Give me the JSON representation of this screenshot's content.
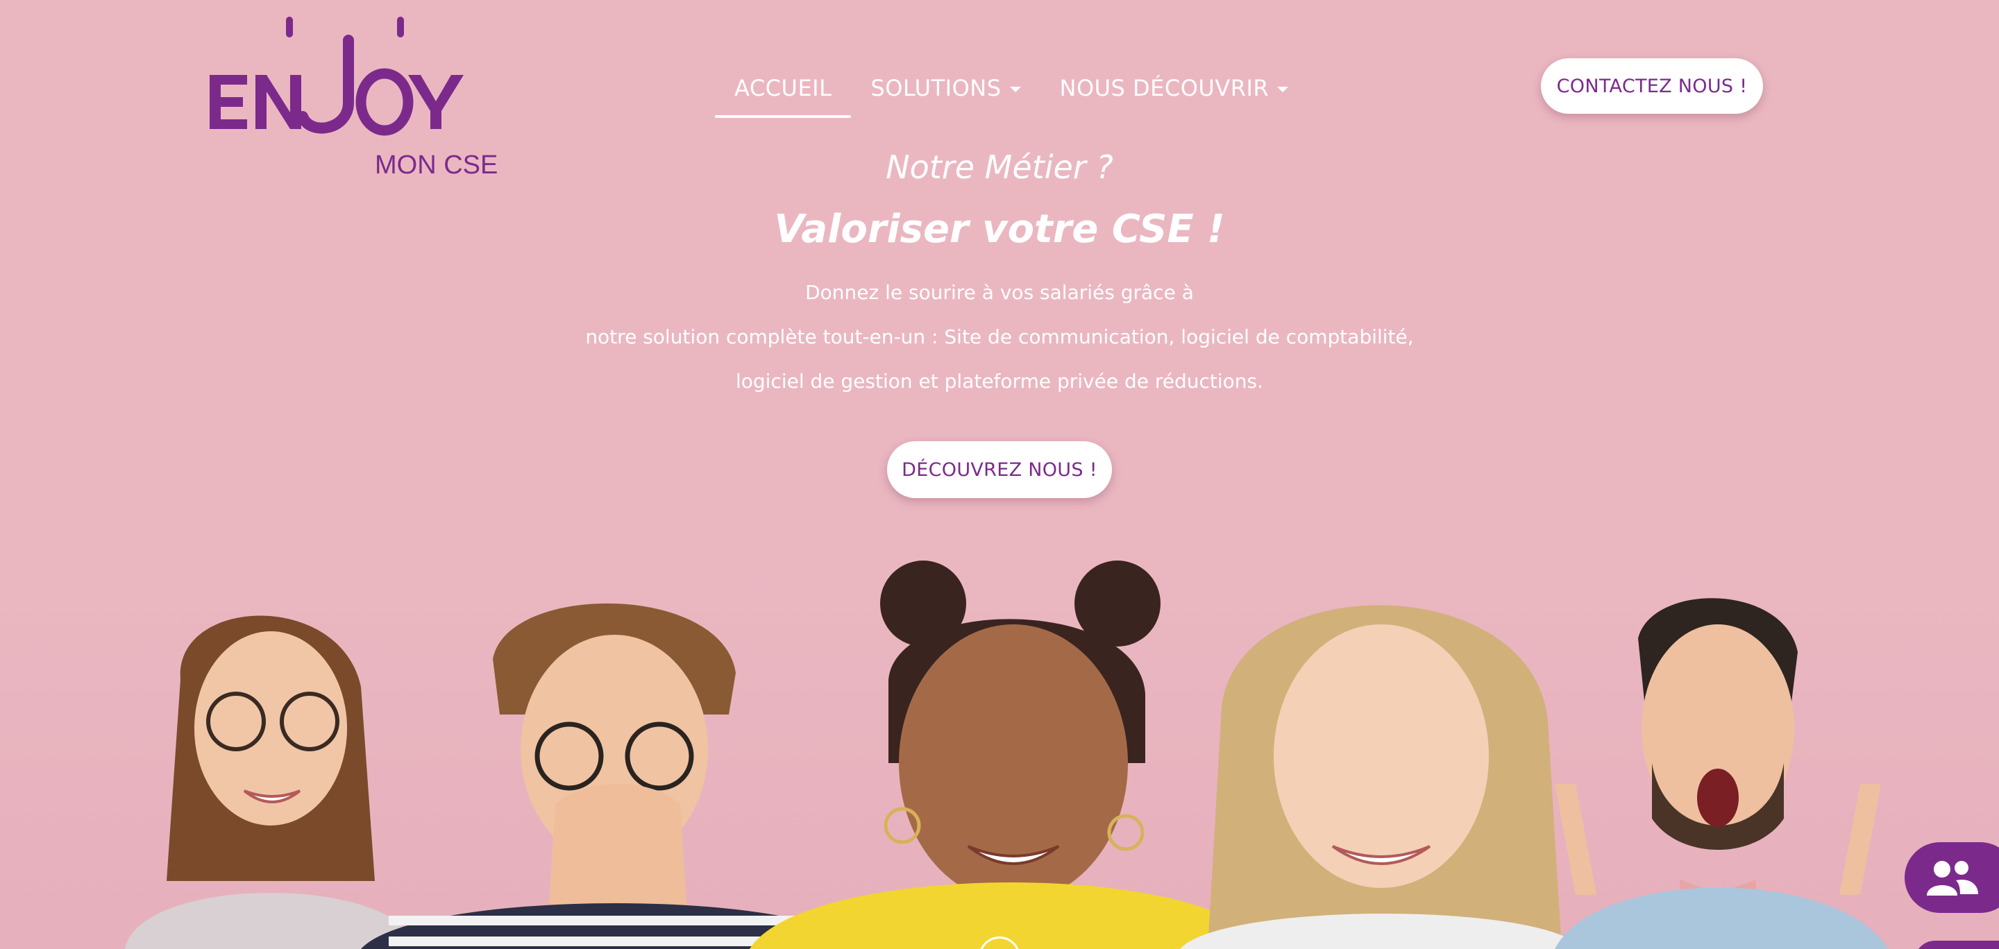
{
  "logo": {
    "word": "ENJOY",
    "sub": "MON CSE",
    "color": "#7b2a8c"
  },
  "nav": {
    "items": [
      {
        "label": "ACCUEIL",
        "active": true,
        "dropdown": false
      },
      {
        "label": "SOLUTIONS",
        "active": false,
        "dropdown": true
      },
      {
        "label": "NOUS DÉCOUVRIR",
        "active": false,
        "dropdown": true
      }
    ],
    "contact_label": "CONTACTEZ NOUS !"
  },
  "hero": {
    "kicker": "Notre Métier ?",
    "title": "Valoriser votre CSE !",
    "lines": [
      "Donnez le sourire à vos salariés grâce à",
      "notre solution complète tout-en-un : Site de communication, logiciel de comptabilité,",
      "logiciel de gestion et plateforme privée de réductions."
    ],
    "cta_label": "DÉCOUVREZ NOUS !"
  },
  "widgets": {
    "chat_icon": "users-icon"
  },
  "colors": {
    "background": "#eab7c1",
    "accent": "#7b2a8c",
    "text": "#ffffff"
  }
}
